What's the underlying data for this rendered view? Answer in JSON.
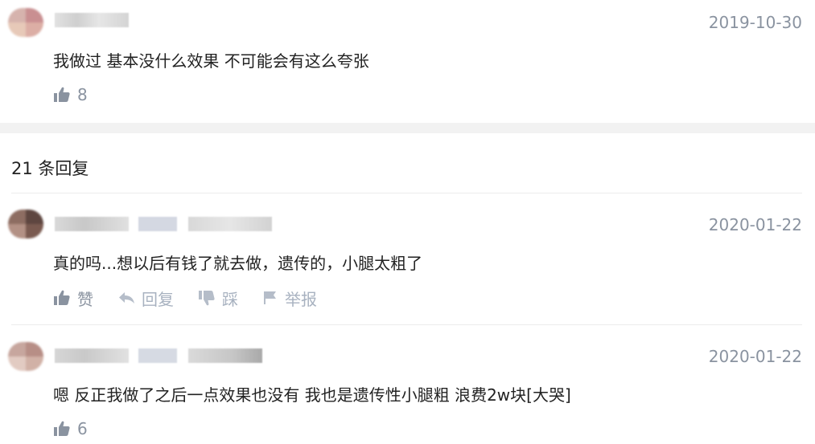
{
  "top_comment": {
    "date": "2019-10-30",
    "text": "我做过 基本没什么效果 不可能会有这么夸张",
    "likes": "8"
  },
  "replies_header": {
    "count_label": "21 条回复"
  },
  "replies": [
    {
      "date": "2020-01-22",
      "text": "真的吗...想以后有钱了就去做，遗传的，小腿太粗了",
      "like_label": "赞",
      "reply_label": "回复",
      "dislike_label": "踩",
      "report_label": "举报"
    },
    {
      "date": "2020-01-22",
      "text": "嗯 反正我做了之后一点效果也没有 我也是遗传性小腿粗 浪费2w块[大哭]",
      "likes": "6"
    }
  ],
  "colors": {
    "date": "#8a93a0",
    "action": "#a8b2c0",
    "text": "#222222",
    "band": "#f2f2f2"
  },
  "icons": {
    "like": "thumb-up-icon",
    "reply": "reply-arrow-icon",
    "dislike": "thumb-down-icon",
    "report": "flag-icon"
  }
}
